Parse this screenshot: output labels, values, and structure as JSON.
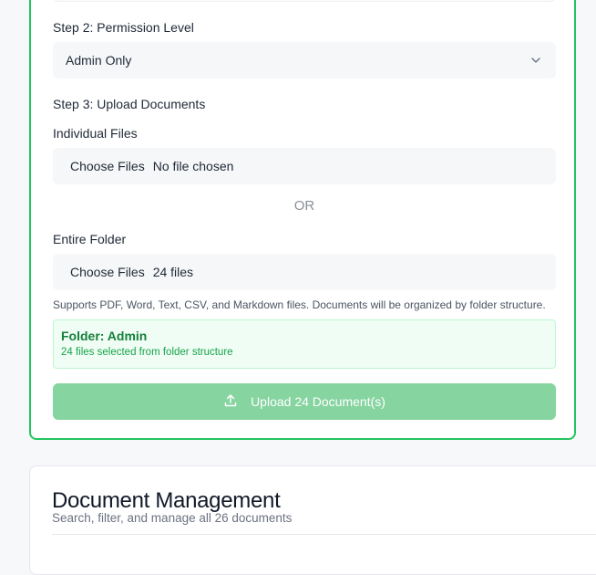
{
  "upload_form": {
    "step2_label": "Step 2: Permission Level",
    "permission_value": "Admin Only",
    "step3_label": "Step 3: Upload Documents",
    "individual_label": "Individual Files",
    "individual_button": "Choose Files",
    "individual_status": "No file chosen",
    "or_text": "OR",
    "folder_label": "Entire Folder",
    "folder_button": "Choose Files",
    "folder_status": "24 files",
    "supports_text": "Supports PDF, Word, Text, CSV, and Markdown files. Documents will be organized by folder structure.",
    "folder_info_title": "Folder: Admin",
    "folder_info_sub": "24 files selected from folder structure",
    "upload_button_label": "Upload 24 Document(s)"
  },
  "document_management": {
    "title": "Document Management",
    "subtitle": "Search, filter, and manage all 26 documents"
  },
  "icons": {
    "select_chevron": "chevron-down-icon",
    "upload": "upload-icon"
  },
  "colors": {
    "accent_green": "#22c55e",
    "upload_button_disabled": "#86d4a0",
    "folder_info_bg": "#f0fdf4",
    "folder_info_text": "#15803d"
  }
}
